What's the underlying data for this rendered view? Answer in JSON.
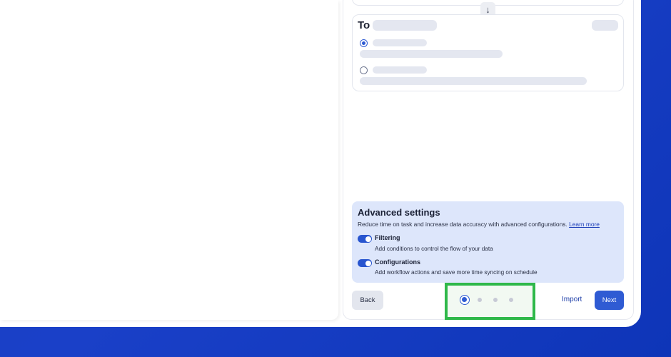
{
  "colors": {
    "accent": "#2f5bd3",
    "highlight_border": "#2fb84a",
    "advanced_bg": "#dde6fb",
    "background_gradient": "#1c3fc2"
  },
  "swap": {
    "icon": "arrow-down-icon",
    "glyph": "↓"
  },
  "to_section": {
    "title": "To",
    "options": [
      {
        "selected": true
      },
      {
        "selected": false
      }
    ]
  },
  "advanced_settings": {
    "title": "Advanced settings",
    "description": "Reduce time on task and increase data accuracy with advanced configurations.",
    "learn_more": "Learn more",
    "toggles": [
      {
        "label": "Filtering",
        "description": "Add conditions to control the flow of your data",
        "enabled": true
      },
      {
        "label": "Configurations",
        "description": "Add workflow actions and save more time syncing on schedule",
        "enabled": true
      }
    ]
  },
  "footer": {
    "back_label": "Back",
    "import_label": "Import",
    "next_label": "Next",
    "stepper": {
      "total_steps": 4,
      "current_step": 1
    }
  }
}
